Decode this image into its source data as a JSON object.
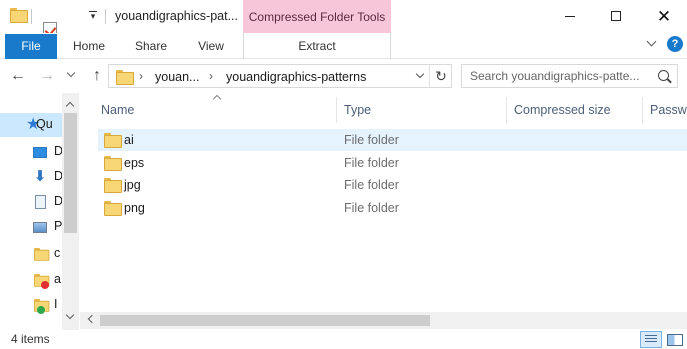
{
  "titlebar": {
    "title": "youandigraphics-pat...",
    "context_tab_header": "Compressed Folder Tools",
    "close_symbol": "✕"
  },
  "ribbon": {
    "tabs": [
      "File",
      "Home",
      "Share",
      "View",
      "Extract"
    ],
    "help_symbol": "?"
  },
  "nav": {
    "back_symbol": "←",
    "forward_symbol": "→",
    "up_symbol": "↑",
    "breadcrumb": [
      "youan...",
      "youandigraphics-patterns"
    ],
    "crumb_separator": "›",
    "refresh_symbol": "↻",
    "search_placeholder": "Search youandigraphics-patte..."
  },
  "navpane": {
    "items": [
      {
        "label": "Qu",
        "icon": "star-icon"
      },
      {
        "label": "D",
        "icon": "desktop-icon"
      },
      {
        "label": "D",
        "icon": "download-icon"
      },
      {
        "label": "D",
        "icon": "document-icon"
      },
      {
        "label": "P",
        "icon": "pictures-icon"
      },
      {
        "label": "c",
        "icon": "folder-icon"
      },
      {
        "label": "a",
        "icon": "folder-icon"
      },
      {
        "label": "I",
        "icon": "folder-icon"
      }
    ]
  },
  "filelist": {
    "columns": [
      "Name",
      "Type",
      "Compressed size",
      "Passwo"
    ],
    "rows": [
      {
        "name": "ai",
        "type": "File folder"
      },
      {
        "name": "eps",
        "type": "File folder"
      },
      {
        "name": "jpg",
        "type": "File folder"
      },
      {
        "name": "png",
        "type": "File folder"
      }
    ]
  },
  "status": {
    "item_count": "4 items"
  },
  "colors": {
    "file_tab": "#1979ca",
    "context_tab": "#f7c6d9",
    "selection": "#cce8ff",
    "folder": "#f7d675"
  }
}
